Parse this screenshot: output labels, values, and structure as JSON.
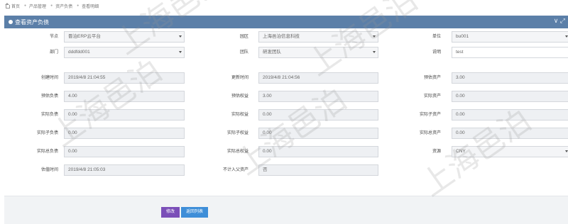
{
  "breadcrumb": [
    "首页",
    "产品管理",
    "资产负债",
    "查看明细"
  ],
  "panel": {
    "title": "查看资产负债",
    "collapse_glyph": "∨ ⤢"
  },
  "rows": [
    [
      {
        "label": "节点",
        "value": "晋泊ERP云平台",
        "type": "select"
      },
      {
        "label": "园区",
        "value": "上海邑泊信息科技",
        "type": "select"
      },
      {
        "label": "单位",
        "value": "bu001",
        "type": "select"
      }
    ],
    [
      {
        "label": "部门",
        "value": "dddfdd001",
        "type": "select"
      },
      {
        "label": "团队",
        "value": "研发团队",
        "type": "select"
      },
      {
        "label": "说明",
        "value": "test",
        "type": "text"
      }
    ],
    [
      {
        "label": "创建时间",
        "value": "2019/4/8 21:04:55",
        "type": "text"
      },
      {
        "label": "更新时间",
        "value": "2019/4/8 21:04:56",
        "type": "text"
      },
      {
        "label": "预估资产",
        "value": "3.00",
        "type": "text"
      }
    ],
    [
      {
        "label": "预估负债",
        "value": "4.00",
        "type": "text"
      },
      {
        "label": "预估权益",
        "value": "3.00",
        "type": "text"
      },
      {
        "label": "实际资产",
        "value": "0.00",
        "type": "text"
      }
    ],
    [
      {
        "label": "实际负债",
        "value": "0.00",
        "type": "text"
      },
      {
        "label": "实际权益",
        "value": "0.00",
        "type": "text"
      },
      {
        "label": "实际子资产",
        "value": "0.00",
        "type": "text"
      }
    ],
    [
      {
        "label": "实际子负债",
        "value": "0.00",
        "type": "text"
      },
      {
        "label": "实际子权益",
        "value": "0.00",
        "type": "text"
      },
      {
        "label": "实际总资产",
        "value": "0.00",
        "type": "text"
      }
    ],
    [
      {
        "label": "实际总负债",
        "value": "0.00",
        "type": "text"
      },
      {
        "label": "实际总权益",
        "value": "0.00",
        "type": "text"
      },
      {
        "label": "资源",
        "value": "CNY",
        "type": "select"
      }
    ],
    [
      {
        "label": "估值时间",
        "value": "2019/4/8 21:05:03",
        "type": "text"
      },
      {
        "label": "不计入父资产",
        "value": "否",
        "type": "text"
      }
    ]
  ],
  "buttons": {
    "edit": "修改",
    "back": "返回列表"
  },
  "watermark": "上海邑泊"
}
